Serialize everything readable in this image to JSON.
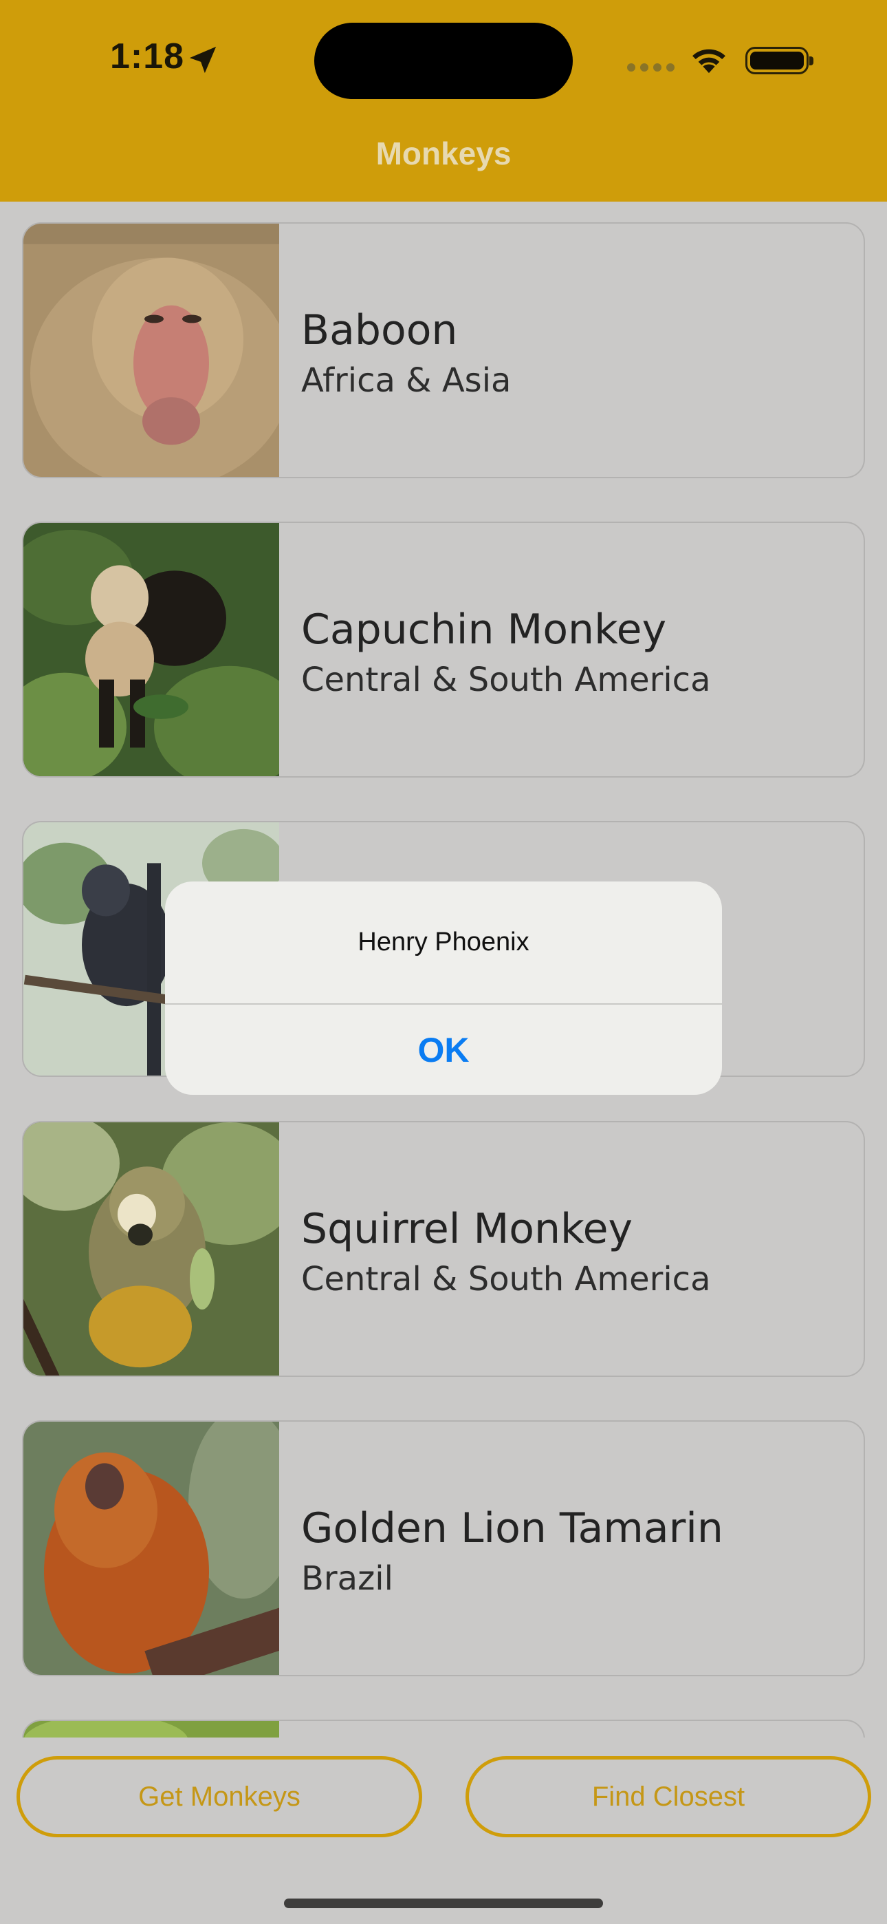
{
  "status_bar": {
    "time": "1:18"
  },
  "nav": {
    "title": "Monkeys"
  },
  "monkeys": [
    {
      "name": "Baboon",
      "location": "Africa & Asia"
    },
    {
      "name": "Capuchin Monkey",
      "location": "Central & South America"
    },
    {
      "name": "",
      "location": ""
    },
    {
      "name": "Squirrel Monkey",
      "location": "Central & South America"
    },
    {
      "name": "Golden Lion Tamarin",
      "location": "Brazil"
    },
    {
      "name": "",
      "location": ""
    }
  ],
  "buttons": {
    "get_monkeys": "Get Monkeys",
    "find_closest": "Find Closest"
  },
  "alert": {
    "message": "Henry Phoenix",
    "ok": "OK"
  },
  "colors": {
    "accent": "#cf9d0a",
    "ok_blue": "#0a7cf2",
    "background": "#cac9c8"
  }
}
